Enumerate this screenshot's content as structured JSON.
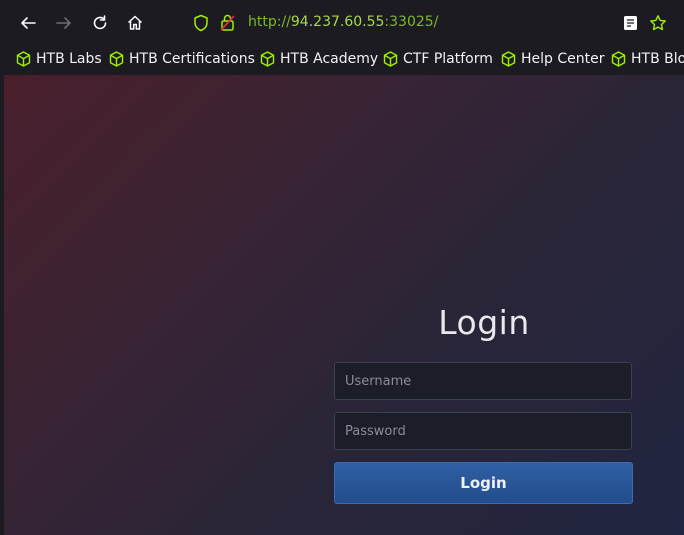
{
  "browser": {
    "url": {
      "scheme": "http://",
      "host": "94.237.60.55",
      "port_path": ":33025/"
    },
    "icons": {
      "back": "arrow-left-icon",
      "forward": "arrow-right-icon",
      "reload": "reload-icon",
      "home": "home-icon",
      "shield": "tracking-protection-shield-icon",
      "lock": "insecure-lock-icon",
      "reader": "reader-view-icon",
      "bookmark": "star-icon"
    },
    "colors": {
      "url_green": "#7fb82a",
      "bookmark_icon_green": "#9fef00"
    }
  },
  "bookmarks": [
    {
      "label": "HTB Labs"
    },
    {
      "label": "HTB Certifications"
    },
    {
      "label": "HTB Academy"
    },
    {
      "label": "CTF Platform"
    },
    {
      "label": "Help Center"
    },
    {
      "label": "HTB Blo"
    }
  ],
  "login": {
    "title": "Login",
    "username_placeholder": "Username",
    "password_placeholder": "Password",
    "submit_label": "Login"
  }
}
